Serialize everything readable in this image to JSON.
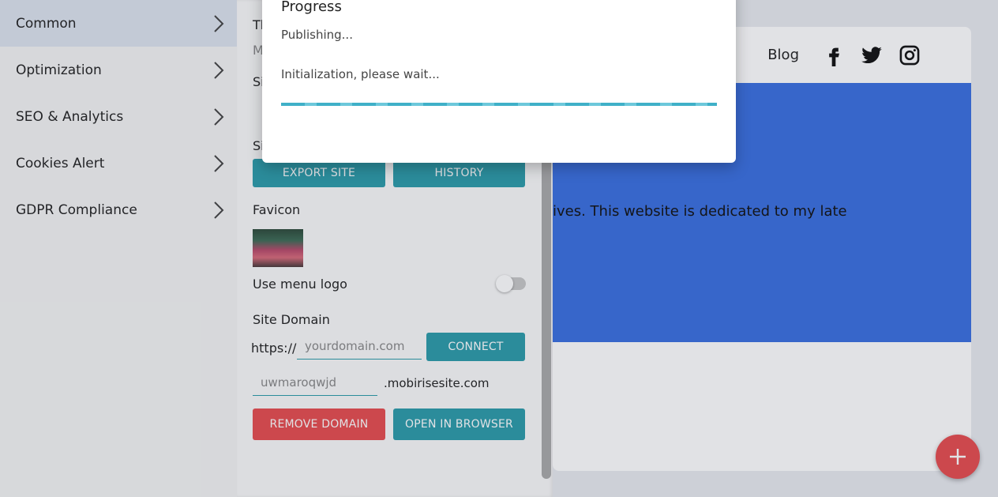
{
  "sidebar": {
    "items": [
      {
        "label": "Common",
        "active": true
      },
      {
        "label": "Optimization"
      },
      {
        "label": "SEO & Analytics"
      },
      {
        "label": "Cookies Alert"
      },
      {
        "label": "GDPR Compliance"
      }
    ]
  },
  "panel": {
    "export_button": "EXPORT SITE",
    "history_button": "HISTORY",
    "favicon_label": "Favicon",
    "menu_logo_label": "Use menu logo",
    "menu_logo_enabled": false,
    "site_domain_label": "Site Domain",
    "domain_prefix": "https://",
    "domain_placeholder": "yourdomain.com",
    "connect_button": "CONNECT",
    "subdomain_placeholder": "uwmaroqwjd",
    "subdomain_suffix": ".mobirisesite.com",
    "remove_domain_button": "REMOVE DOMAIN",
    "open_browser_button": "OPEN IN BROWSER",
    "partial_labels": [
      "Th",
      "M",
      "Si",
      "Si"
    ]
  },
  "preview": {
    "nav_link": "Blog",
    "hero_text": "ives. This website is dedicated to my late",
    "social_icons": [
      "facebook-icon",
      "twitter-icon",
      "instagram-icon"
    ]
  },
  "modal": {
    "title": "Progress",
    "status": "Publishing...",
    "message": "Initialization, please wait..."
  },
  "colors": {
    "accent": "#2c9ba9",
    "danger": "#e74c4f",
    "hero": "#3a6fe0"
  }
}
